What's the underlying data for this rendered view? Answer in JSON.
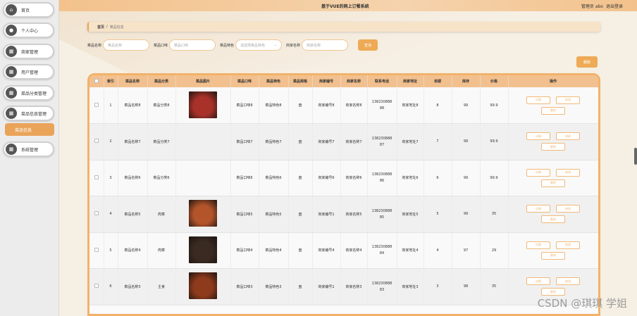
{
  "app": {
    "title": "基于VUE的网上订餐系统",
    "user_label": "管理员 abo",
    "logout": "退出登录"
  },
  "sidebar": {
    "items": [
      {
        "label": "首页",
        "icon": "home-icon"
      },
      {
        "label": "个人中心",
        "icon": "user-icon"
      },
      {
        "label": "商家管理",
        "icon": "grid-icon"
      },
      {
        "label": "用户管理",
        "icon": "grid-icon"
      },
      {
        "label": "菜品分类管理",
        "icon": "grid-icon"
      },
      {
        "label": "菜品信息管理",
        "icon": "grid-icon"
      },
      {
        "label": "系统管理",
        "icon": "grid-icon"
      }
    ],
    "sub_item": "菜品信息"
  },
  "breadcrumb": {
    "home": "首页",
    "sep": "/",
    "current": "菜品信息"
  },
  "search": {
    "name_label": "菜品名称",
    "name_placeholder": "菜品名称",
    "taste_label": "菜品口味",
    "taste_placeholder": "菜品口味",
    "special_label": "菜品特色",
    "special_placeholder": "请选择菜品特色",
    "merchant_label": "商家名称",
    "merchant_placeholder": "商家名称",
    "button": "查询"
  },
  "delete_button": "删除",
  "table": {
    "headers": [
      "",
      "索引",
      "菜品名称",
      "菜品分类",
      "菜品图片",
      "菜品口味",
      "菜品特色",
      "菜品规格",
      "商家编号",
      "商家名称",
      "联系电话",
      "商家地址",
      "单期",
      "库存",
      "价格",
      "操作"
    ],
    "rows": [
      {
        "idx": "1",
        "name": "菜品名称8",
        "cat": "菜品分类8",
        "img": true,
        "img_color": "#a8322a",
        "taste": "菜品口味8",
        "special": "菜品特色8",
        "spec": "盘",
        "mno": "商家编号8",
        "mname": "商家名称8",
        "phone1": "138230888",
        "phone2": "88",
        "addr": "商家地址8",
        "period": "8",
        "stock": "99",
        "price": "99.9"
      },
      {
        "idx": "2",
        "name": "菜品名称7",
        "cat": "菜品分类7",
        "img": false,
        "img_color": "",
        "taste": "菜品口味7",
        "special": "菜品特色7",
        "spec": "盘",
        "mno": "商家编号7",
        "mname": "商家名称7",
        "phone1": "138230888",
        "phone2": "87",
        "addr": "商家地址7",
        "period": "7",
        "stock": "99",
        "price": "99.9"
      },
      {
        "idx": "3",
        "name": "菜品名称6",
        "cat": "菜品分类6",
        "img": false,
        "img_color": "",
        "taste": "菜品口味6",
        "special": "菜品特色6",
        "spec": "盘",
        "mno": "商家编号6",
        "mname": "商家名称6",
        "phone1": "138230888",
        "phone2": "86",
        "addr": "商家地址6",
        "period": "6",
        "stock": "99",
        "price": "99.9"
      },
      {
        "idx": "4",
        "name": "菜品名称5",
        "cat": "肉菜",
        "img": true,
        "img_color": "#b3542b",
        "taste": "菜品口味5",
        "special": "菜品特色5",
        "spec": "盘",
        "mno": "商家编号1",
        "mname": "商家名称5",
        "phone1": "138230888",
        "phone2": "85",
        "addr": "商家地址5",
        "period": "5",
        "stock": "99",
        "price": "35"
      },
      {
        "idx": "5",
        "name": "菜品名称4",
        "cat": "肉菜",
        "img": true,
        "img_color": "#3a2a22",
        "taste": "菜品口味4",
        "special": "菜品特色4",
        "spec": "盘",
        "mno": "商家编号4",
        "mname": "商家名称4",
        "phone1": "138230888",
        "phone2": "84",
        "addr": "商家地址4",
        "period": "4",
        "stock": "97",
        "price": "29"
      },
      {
        "idx": "6",
        "name": "菜品名称3",
        "cat": "主食",
        "img": true,
        "img_color": "#8e3a1c",
        "taste": "菜品口味3",
        "special": "菜品特色3",
        "spec": "盘",
        "mno": "商家编号1",
        "mname": "商家名称3",
        "phone1": "138230888",
        "phone2": "83",
        "addr": "商家地址3",
        "period": "3",
        "stock": "98",
        "price": "35"
      }
    ],
    "ops": {
      "detail": "详情",
      "edit": "修改",
      "delete": "删除"
    }
  },
  "watermark": "CSDN @琪琪 学姐"
}
